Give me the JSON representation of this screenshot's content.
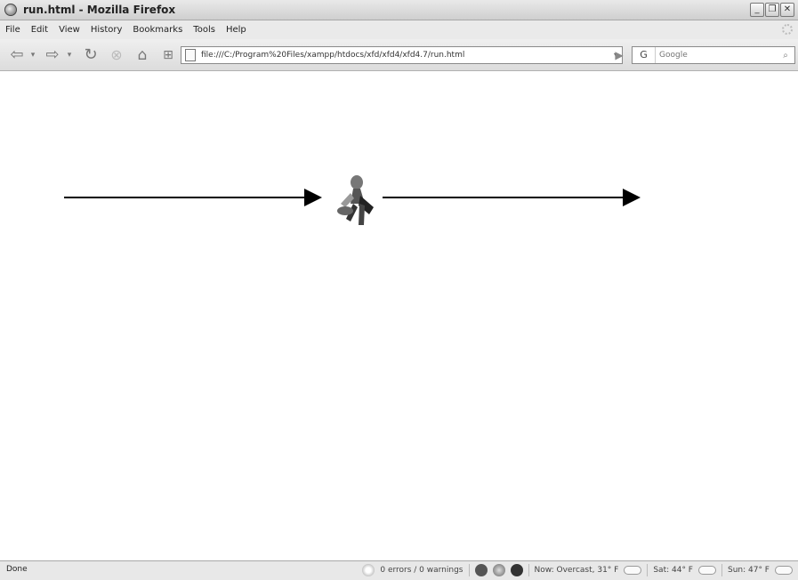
{
  "window": {
    "title": "run.html - Mozilla Firefox"
  },
  "menubar": {
    "items": [
      "File",
      "Edit",
      "View",
      "History",
      "Bookmarks",
      "Tools",
      "Help"
    ]
  },
  "navbar": {
    "url": "file:///C:/Program%20Files/xampp/htdocs/xfd/xfd4/xfd4.7/run.html",
    "search_placeholder": "Google",
    "search_engine": "G"
  },
  "statusbar": {
    "status": "Done",
    "errors": "0 errors / 0 warnings",
    "weather_now": "Now: Overcast, 31° F",
    "weather_sat": "Sat: 44° F",
    "weather_sun": "Sun: 47° F"
  },
  "colors": {
    "arrow": "#000000",
    "chrome": "#e9e9e9"
  }
}
